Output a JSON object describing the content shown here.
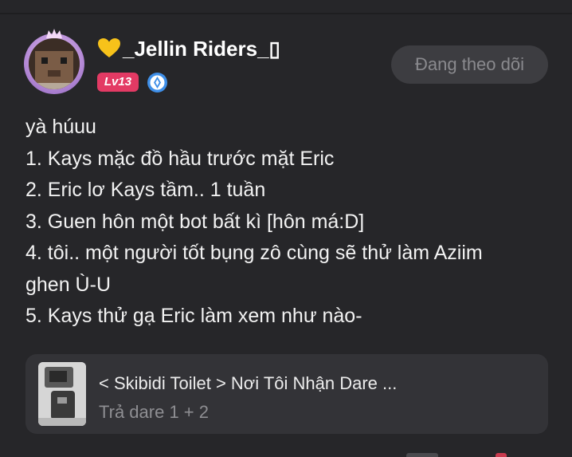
{
  "post": {
    "author": {
      "heart_icon": "yellow-heart-emoji",
      "name": "_Jellin Riders_▯",
      "level": "Lv13",
      "badge_icon": "blue-verified-badge"
    },
    "follow_button_label": "Đang theo dõi",
    "body_lines": [
      "yà húuu",
      "1. Kays mặc đồ hầu trước mặt Eric",
      "2. Eric lơ Kays tầm.. 1 tuần",
      "3. Guen hôn một bot bất kì [hôn má:D]",
      "4. tôi.. một người tốt bụng zô cùng sẽ thử làm Aziim",
      "ghen Ù-U",
      "5. Kays thử gạ Eric làm xem như nào-"
    ],
    "linked_story": {
      "title": "< Skibidi Toilet > Nơi Tôi Nhận Dare ...",
      "subtitle": "Trả dare 1 + 2"
    }
  },
  "colors": {
    "background": "#262629",
    "level_badge": "#e33a64",
    "follow_button_bg": "#3d3d41",
    "card_bg": "#333337"
  }
}
